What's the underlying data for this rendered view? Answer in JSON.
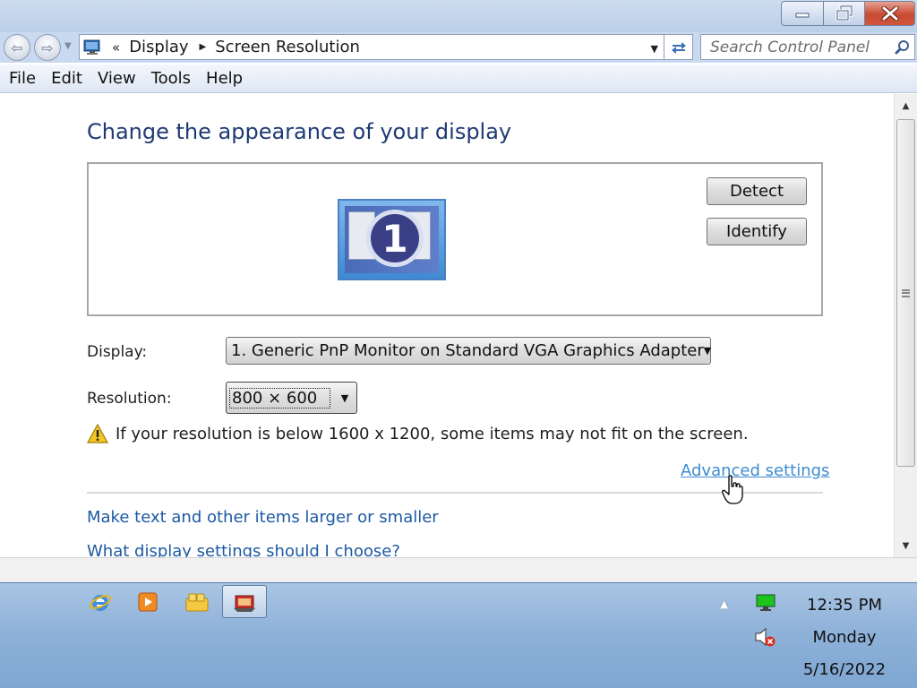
{
  "window": {
    "buttons": {
      "minimize": "minimize-icon",
      "maximize": "restore-icon",
      "close": "close-icon"
    }
  },
  "navbar": {
    "breadcrumb_sep": "«",
    "breadcrumbs": [
      "Display",
      "Screen Resolution"
    ],
    "search_placeholder": "Search Control Panel"
  },
  "menu": [
    "File",
    "Edit",
    "View",
    "Tools",
    "Help"
  ],
  "main": {
    "title": "Change the appearance of your display",
    "monitor_number": "1",
    "detect_label": "Detect",
    "identify_label": "Identify",
    "display_label": "Display:",
    "display_value": "1. Generic PnP Monitor on Standard VGA Graphics Adapter",
    "resolution_label": "Resolution:",
    "resolution_value": "800 × 600",
    "warning": "If your resolution is below 1600 x 1200, some items may not fit on the screen.",
    "advanced_link": "Advanced settings",
    "link1": "Make text and other items larger or smaller",
    "link2": "What display settings should I choose?"
  },
  "taskbar": {
    "apps": [
      "internet-explorer-icon",
      "media-player-icon",
      "windows-explorer-icon",
      "display-settings-icon"
    ],
    "time": "12:35 PM",
    "day": "Monday",
    "date": "5/16/2022"
  },
  "colors": {
    "title_text": "#1f3a74",
    "link": "#1c59a4",
    "link_hover": "#3e8bd0",
    "taskbar": "#8fb2d9"
  }
}
